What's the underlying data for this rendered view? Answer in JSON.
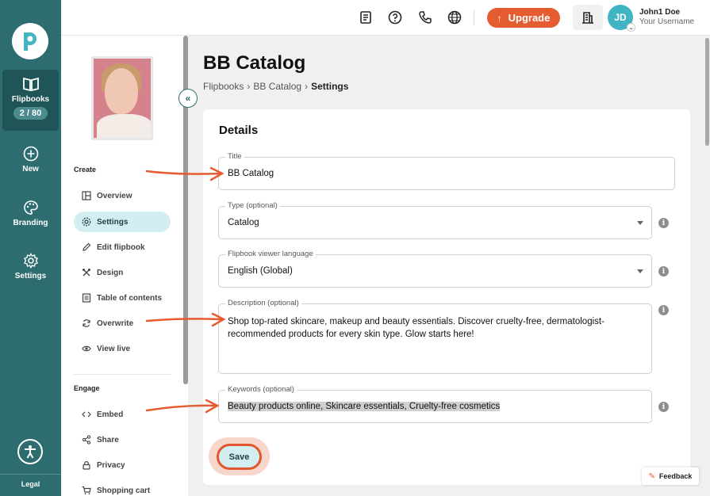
{
  "rail": {
    "items": [
      {
        "label": "Flipbooks",
        "counter": "2 / 80",
        "icon": "book-open-icon"
      },
      {
        "label": "New",
        "icon": "plus-circle-icon"
      },
      {
        "label": "Branding",
        "icon": "palette-icon"
      },
      {
        "label": "Settings",
        "icon": "gear-icon"
      }
    ],
    "legal": "Legal"
  },
  "topbar": {
    "upgrade_label": "Upgrade",
    "avatar_initials": "JD",
    "user_name": "John1 Doe",
    "user_sub": "Your Username"
  },
  "sidebar": {
    "section_create": "Create",
    "create_items": [
      {
        "label": "Overview",
        "icon": "layout-icon"
      },
      {
        "label": "Settings",
        "icon": "gear-icon",
        "active": true
      },
      {
        "label": "Edit flipbook",
        "icon": "pencil-icon"
      },
      {
        "label": "Design",
        "icon": "tools-icon"
      },
      {
        "label": "Table of contents",
        "icon": "list-icon"
      },
      {
        "label": "Overwrite",
        "icon": "refresh-icon"
      },
      {
        "label": "View live",
        "icon": "eye-icon"
      }
    ],
    "section_engage": "Engage",
    "engage_items": [
      {
        "label": "Embed",
        "icon": "code-icon"
      },
      {
        "label": "Share",
        "icon": "share-icon"
      },
      {
        "label": "Privacy",
        "icon": "lock-icon"
      },
      {
        "label": "Shopping cart",
        "icon": "cart-icon"
      }
    ]
  },
  "main": {
    "title": "BB Catalog",
    "breadcrumb": [
      "Flipbooks",
      "BB Catalog",
      "Settings"
    ],
    "card_title": "Details",
    "fields": {
      "title": {
        "label": "Title",
        "value": "BB Catalog"
      },
      "type": {
        "label": "Type (optional)",
        "value": "Catalog"
      },
      "language": {
        "label": "Flipbook viewer language",
        "value": "English (Global)"
      },
      "description": {
        "label": "Description (optional)",
        "value": "Shop top-rated skincare, makeup and beauty essentials. Discover cruelty-free, dermatologist-recommended products for every skin type. Glow starts here!"
      },
      "keywords": {
        "label": "Keywords (optional)",
        "value": "Beauty products online, Skincare essentials, Cruelty-free cosmetics"
      }
    },
    "save_label": "Save"
  },
  "feedback_label": "Feedback",
  "colors": {
    "rail": "#2e6d6f",
    "accent": "#e55c30",
    "active": "#d3eef0"
  }
}
